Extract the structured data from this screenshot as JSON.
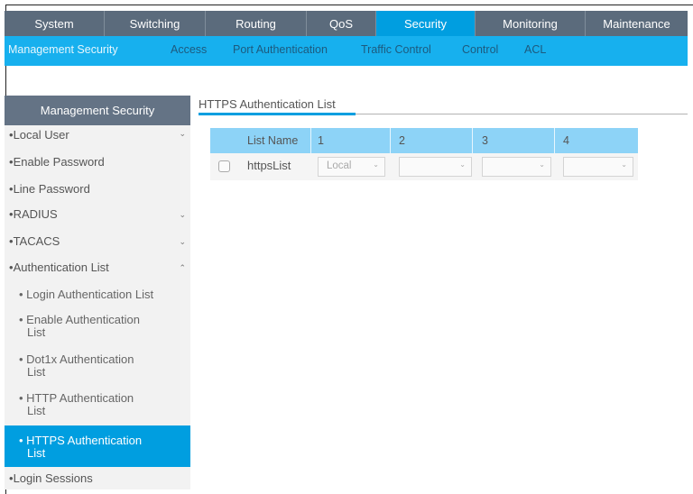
{
  "topnav": {
    "tabs": [
      {
        "label": "System"
      },
      {
        "label": "Switching"
      },
      {
        "label": "Routing"
      },
      {
        "label": "QoS"
      },
      {
        "label": "Security"
      },
      {
        "label": "Monitoring"
      },
      {
        "label": "Maintenance"
      }
    ],
    "active": "Security"
  },
  "subnav": {
    "items": [
      {
        "label": "Management Security"
      },
      {
        "label": "Access"
      },
      {
        "label": "Port Authentication"
      },
      {
        "label": "Traffic Control"
      },
      {
        "label": "Control"
      },
      {
        "label": "ACL"
      }
    ],
    "active": "Management Security"
  },
  "sidebar": {
    "header": "Management Security",
    "items": [
      {
        "label": "Local User",
        "icon": "chevron-down-icon"
      },
      {
        "label": "Enable Password"
      },
      {
        "label": "Line Password"
      },
      {
        "label": "RADIUS",
        "icon": "chevron-down-icon"
      },
      {
        "label": "TACACS",
        "icon": "chevron-down-icon"
      },
      {
        "label": "Authentication List",
        "icon": "chevron-up-icon"
      }
    ],
    "subitems": [
      {
        "line1": "Login Authentication List",
        "line2": ""
      },
      {
        "line1": "Enable Authentication",
        "line2": "List"
      },
      {
        "line1": "Dot1x Authentication",
        "line2": "List"
      },
      {
        "line1": "HTTP Authentication",
        "line2": "List"
      },
      {
        "line1": "HTTPS Authentication",
        "line2": "List"
      }
    ],
    "active_subitem": "HTTPS Authentication List",
    "footer_item": "Login Sessions"
  },
  "main": {
    "title": "HTTPS Authentication List",
    "columns": [
      "List Name",
      "1",
      "2",
      "3",
      "4"
    ],
    "rows": [
      {
        "list_name": "httpsList",
        "selected": false,
        "methods": [
          "Local",
          "",
          "",
          ""
        ]
      }
    ]
  },
  "colors": {
    "topnav_bg": "#5b6b7c",
    "accent": "#009ee0",
    "subnav_bg": "#17b0ee",
    "table_header": "#8dd3f7",
    "sidebar_header": "#647385"
  }
}
